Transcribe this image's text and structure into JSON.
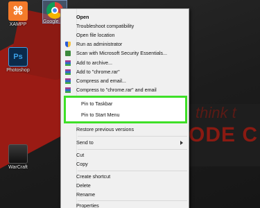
{
  "desktop": {
    "icons": [
      {
        "label": "XAMPP",
        "icon": "xampp-icon"
      },
      {
        "label": "Google",
        "icon": "chrome-icon"
      },
      {
        "label": "Photoshop",
        "icon": "photoshop-icon"
      },
      {
        "label": "WarCraft",
        "icon": "warcraft-icon"
      }
    ]
  },
  "context_menu": {
    "items": [
      {
        "label": "Open",
        "bold": true
      },
      {
        "label": "Troubleshoot compatibility"
      },
      {
        "label": "Open file location"
      },
      {
        "label": "Run as administrator",
        "icon": "uac-shield-icon"
      },
      {
        "label": "Scan with Microsoft Security Essentials...",
        "icon": "security-essentials-icon"
      },
      {
        "label": "Add to archive...",
        "icon": "winrar-icon"
      },
      {
        "label": "Add to \"chrome.rar\"",
        "icon": "winrar-icon"
      },
      {
        "label": "Compress and email...",
        "icon": "winrar-icon"
      },
      {
        "label": "Compress to \"chrome.rar\" and email",
        "icon": "winrar-icon"
      },
      {
        "label": "Pin to Taskbar",
        "highlighted": true
      },
      {
        "label": "Pin to Start Menu",
        "highlighted": true
      },
      {
        "label": "Restore previous versions"
      },
      {
        "label": "Send to",
        "submenu": true
      },
      {
        "label": "Cut"
      },
      {
        "label": "Copy"
      },
      {
        "label": "Create shortcut"
      },
      {
        "label": "Delete"
      },
      {
        "label": "Rename"
      },
      {
        "label": "Properties"
      }
    ]
  },
  "colors": {
    "highlight_border": "#3ee027",
    "menu_background": "#f0f0f0"
  }
}
